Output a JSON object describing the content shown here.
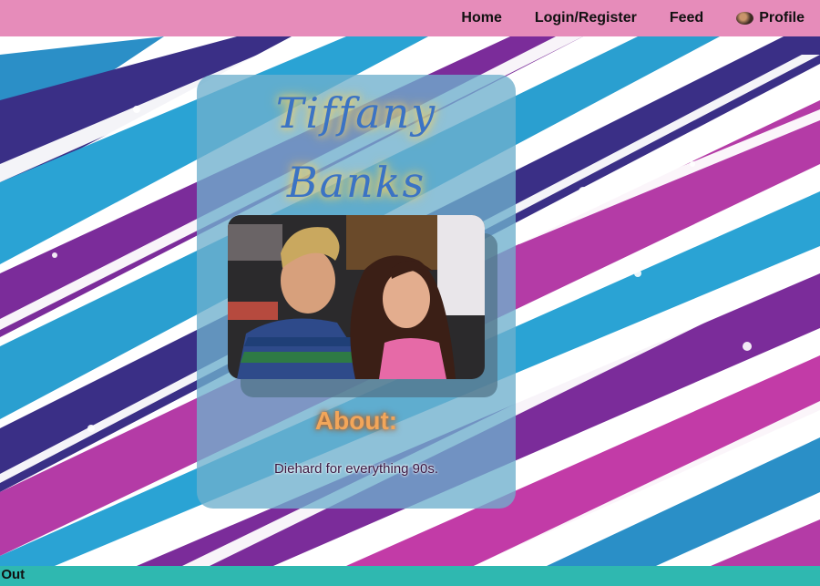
{
  "nav": {
    "home_label": "Home",
    "login_label": "Login/Register",
    "feed_label": "Feed",
    "profile_label": "Profile"
  },
  "profile": {
    "name_line1": "Tiffany",
    "name_line2": "Banks",
    "about_heading": "About:",
    "about_text": "Diehard for everything 90s."
  },
  "footer": {
    "signout_label": "n Out"
  },
  "colors": {
    "nav_bg": "#e68cba",
    "footer_bg": "#2fb8b0",
    "card_bg": "#6eafcd",
    "title_color": "#3b73c4",
    "about_heading_color": "#f2a65a"
  },
  "icons": {
    "profile_avatar": "avatar-icon"
  }
}
